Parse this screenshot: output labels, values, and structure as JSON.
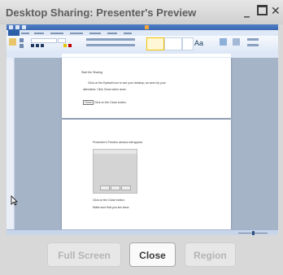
{
  "window": {
    "title": "Desktop Sharing: Presenter's Preview",
    "minimize_glyph": "_",
    "close_glyph": "✕"
  },
  "buttons": {
    "full_screen": "Full Screen",
    "close": "Close",
    "region": "Region"
  },
  "preview": {
    "page1_lines": [
      "Start the Sharing",
      "Click on the Eyeball icon to see your desktop, as seen by your",
      "attendees. Click Close when done.",
      "Click on the Close button."
    ],
    "inline_button": "Close",
    "page2_lines": [
      "Presenter's Preview window will appear",
      "Click on the Close button.",
      "Make sure that you are done."
    ]
  }
}
